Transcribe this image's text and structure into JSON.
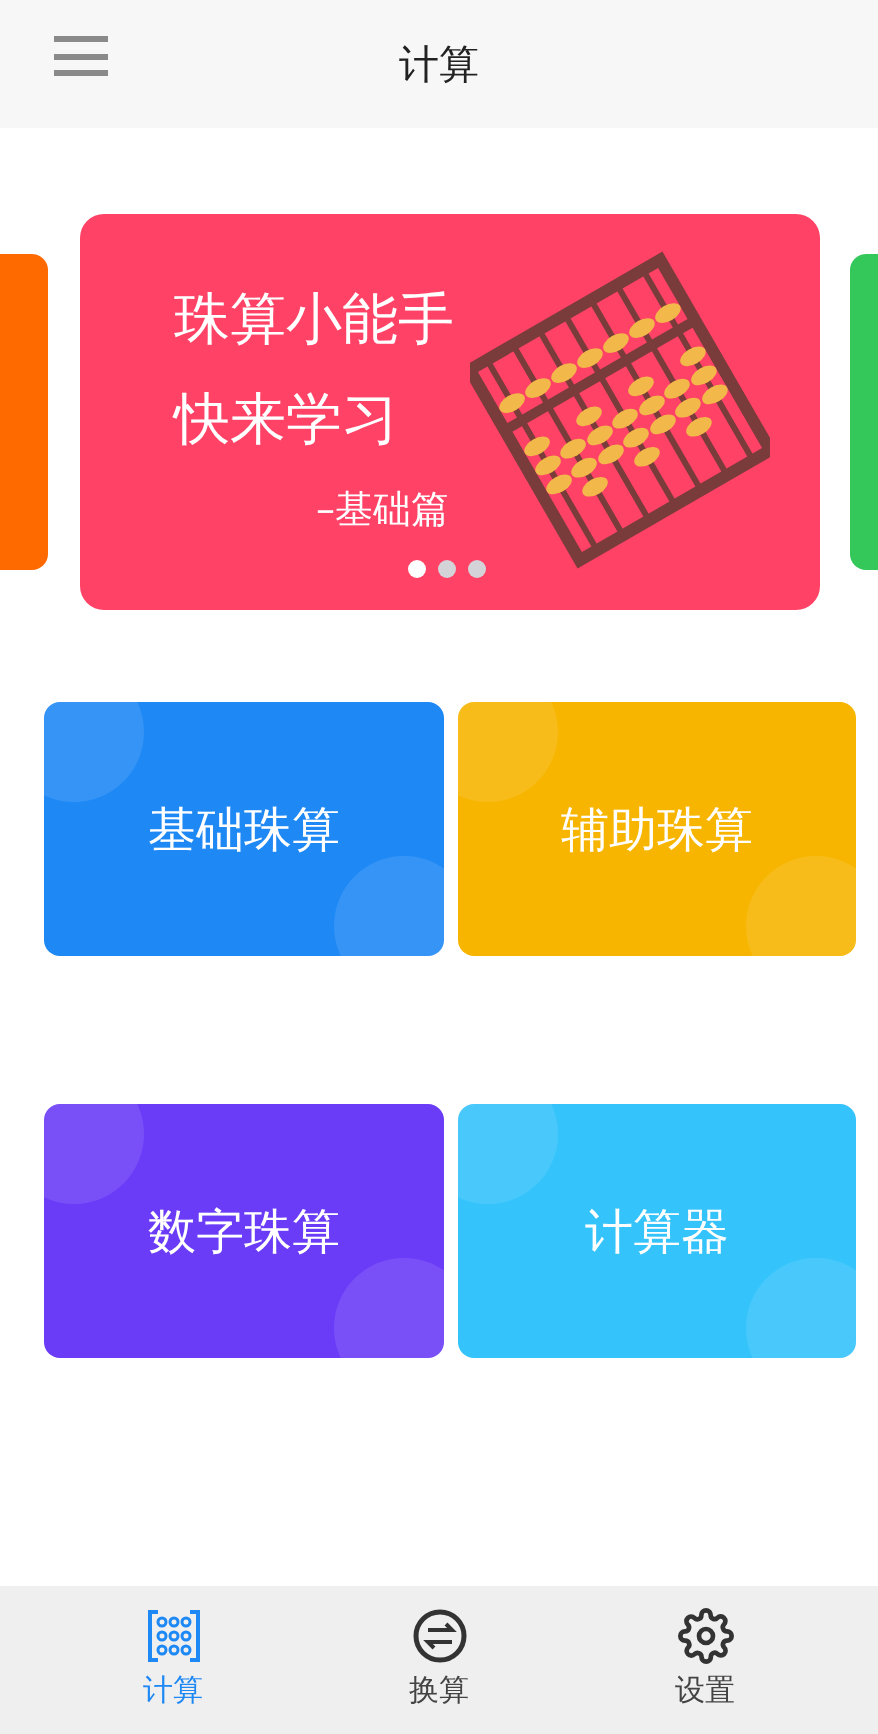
{
  "header": {
    "title": "计算"
  },
  "banner": {
    "lines": [
      "珠算小能手",
      "快来学习"
    ],
    "subtitle": "–基础篇",
    "dots": [
      {
        "selected": true
      },
      {
        "selected": false
      },
      {
        "selected": false
      }
    ]
  },
  "tiles": [
    {
      "label": "基础珠算",
      "color": "#1e88f5"
    },
    {
      "label": "辅助珠算",
      "color": "#f7b500"
    },
    {
      "label": "数字珠算",
      "color": "#6a3cf7"
    },
    {
      "label": "计算器",
      "color": "#35c3fb"
    }
  ],
  "nav": [
    {
      "label": "计算",
      "kind": "abacus",
      "selected": true
    },
    {
      "label": "换算",
      "kind": "exchange",
      "selected": false
    },
    {
      "label": "设置",
      "kind": "gear",
      "selected": false
    }
  ]
}
